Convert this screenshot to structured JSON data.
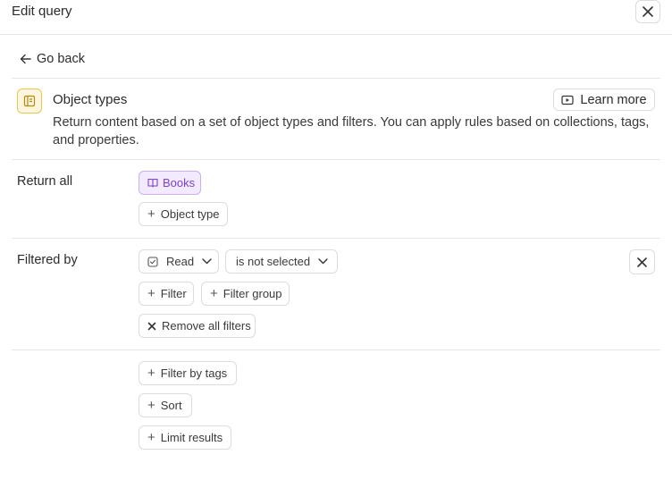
{
  "header": {
    "title": "Edit query",
    "close_icon": "close-icon"
  },
  "nav": {
    "go_back_label": "Go back"
  },
  "object_types": {
    "title": "Object types",
    "description": "Return content based on a set of object types and filters. You can apply rules based on collections, tags, and properties.",
    "learn_more_label": "Learn more",
    "icon": "sidebar-panel-icon",
    "accent_color": "#e8c75a"
  },
  "return_all": {
    "label": "Return all",
    "selected_type": "Books",
    "add_type_label": "Object type",
    "tag_color": "#7a43c9"
  },
  "filtered_by": {
    "label": "Filtered by",
    "filter": {
      "property": "Read",
      "operator": "is not selected"
    },
    "add_filter_label": "Filter",
    "add_filter_group_label": "Filter group",
    "remove_all_label": "Remove all filters"
  },
  "extras": {
    "filter_by_tags_label": "Filter by tags",
    "sort_label": "Sort",
    "limit_results_label": "Limit results"
  }
}
